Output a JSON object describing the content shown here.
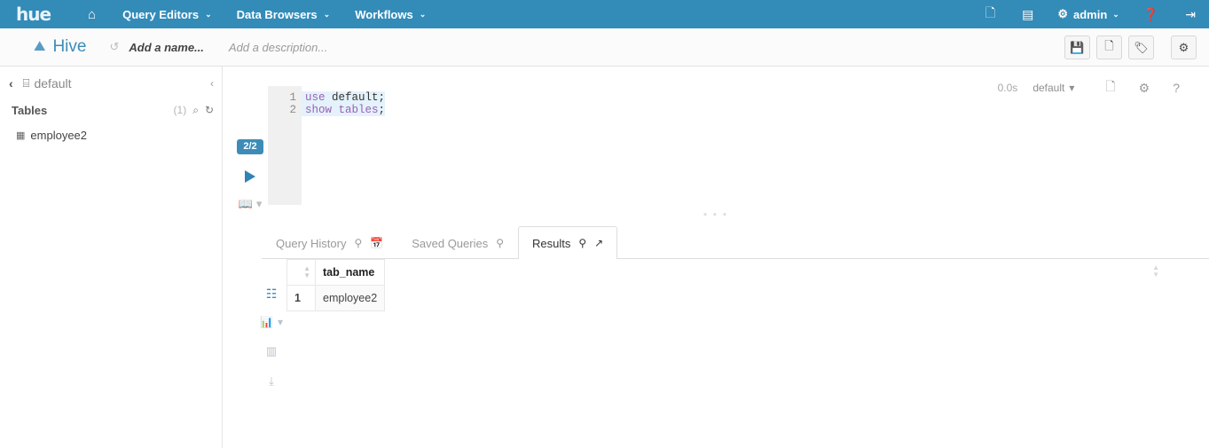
{
  "topnav": {
    "logo": "hue",
    "home_icon": "home-icon",
    "items": [
      {
        "label": "Query Editors",
        "caret": "⌄"
      },
      {
        "label": "Data Browsers",
        "caret": "⌄"
      },
      {
        "label": "Workflows",
        "caret": "⌄"
      }
    ],
    "right": {
      "document_icon": "🗋",
      "jobs_icon": "▤",
      "user_gear_icon": "⚙",
      "user_label": "admin",
      "user_caret": "⌄",
      "help_icon": "?",
      "logout_icon": "⇥"
    },
    "bg_color": "#338bb8"
  },
  "subheader": {
    "app_icon": "hive-icon",
    "app_name": "Hive",
    "history_icon": "↺",
    "name_placeholder": "Add a name...",
    "description_placeholder": "Add a description...",
    "buttons": [
      {
        "name": "save-button",
        "icon": "💾"
      },
      {
        "name": "new-query-button",
        "icon": "🗋"
      },
      {
        "name": "tag-button",
        "icon": "🏷"
      },
      {
        "name": "settings-button",
        "icon": "⚙"
      }
    ],
    "accent_color": "#3d8cb8"
  },
  "sidebar": {
    "back_icon": "‹",
    "db_icon": "⌸",
    "db_name": "default",
    "collapse_icon": "‹",
    "section_label": "Tables",
    "count": "(1)",
    "search_icon": "⌕",
    "refresh_icon": "↻",
    "tables": [
      {
        "icon": "▦",
        "label": "employee2"
      }
    ]
  },
  "editor": {
    "meta": {
      "duration": "0.0s",
      "database": "default",
      "database_caret": "▾",
      "doc_icon": "🗋",
      "gear_icon": "⚙",
      "help_icon": "?"
    },
    "execute": {
      "badge": "2/2",
      "run_icon": "run-icon",
      "book_icon": "📖",
      "book_caret": "▾"
    },
    "lines": [
      {
        "num": "1",
        "keyword": "use",
        "rest": " default;"
      },
      {
        "num": "2",
        "keyword": "show",
        "rest": " tables;"
      }
    ],
    "line1_num": "1",
    "line1_kw": "use",
    "line1_id": " default",
    "line1_semi": ";",
    "line2_num": "2",
    "line2_kw": "show",
    "line2_kw2": " tables",
    "line2_semi": ";",
    "splitter_dots": "▪ ▪ ▪"
  },
  "tabs": [
    {
      "label": "Query History",
      "icons": [
        "⌕",
        "📅"
      ],
      "active": false
    },
    {
      "label": "Saved Queries",
      "icons": [
        "⌕"
      ],
      "active": false
    },
    {
      "label": "Results",
      "icons": [
        "⌕",
        "↗"
      ],
      "active": true
    }
  ],
  "results": {
    "view_icons": {
      "grid_icon": "☷",
      "chart_icon": "📊",
      "chart_caret": "▾",
      "columns_icon": "▥",
      "download_icon": "⤓"
    },
    "columns": [
      "tab_name"
    ],
    "column_sort_icon": "↕",
    "rows": [
      {
        "num": "1",
        "tab_name": "employee2"
      }
    ]
  }
}
